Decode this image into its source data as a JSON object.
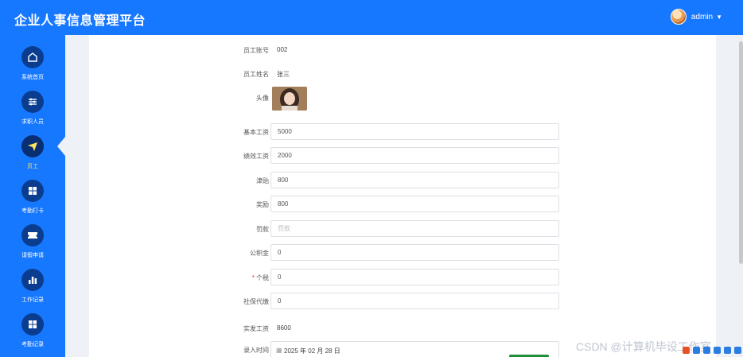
{
  "header": {
    "title": "企业人事信息管理平台",
    "username": "admin"
  },
  "sidebar": {
    "items": [
      {
        "label": "系统首页",
        "icon": "home-icon"
      },
      {
        "label": "求职人员",
        "icon": "sliders-icon"
      },
      {
        "label": "员工",
        "icon": "paper-plane-icon"
      },
      {
        "label": "考勤打卡",
        "icon": "grid-icon"
      },
      {
        "label": "请假申请",
        "icon": "ticket-icon"
      },
      {
        "label": "工作记录",
        "icon": "bar-chart-icon"
      },
      {
        "label": "考勤记录",
        "icon": "grid-icon"
      }
    ],
    "active_index": 2
  },
  "form": {
    "employee_no": {
      "label": "员工账号",
      "value": "002"
    },
    "employee_name": {
      "label": "员工姓名",
      "value": "张三"
    },
    "photo": {
      "label": "头像"
    },
    "base_salary": {
      "label": "基本工资",
      "value": "5000"
    },
    "performance_salary": {
      "label": "绩效工资",
      "value": "2000"
    },
    "allowance": {
      "label": "津贴",
      "value": "800"
    },
    "bonus": {
      "label": "奖励",
      "value": "800"
    },
    "penalty": {
      "label": "罚款",
      "value": "",
      "placeholder": "罚款"
    },
    "housing_fund": {
      "label": "公积金",
      "value": "0"
    },
    "income_tax": {
      "label": "个税",
      "value": "0",
      "required_mark": "*"
    },
    "social_security": {
      "label": "社保代缴",
      "value": "0"
    },
    "net_salary": {
      "label": "实发工资",
      "value": "8600"
    },
    "entry_time": {
      "label": "录入时间",
      "value": "2025 年 02 月 28 日"
    }
  },
  "watermark": "CSDN @计算机毕设工作室",
  "colors": {
    "primary": "#1677ff",
    "nav_icon_bg": "#0a3d8f",
    "active_label": "#ffe65a"
  }
}
